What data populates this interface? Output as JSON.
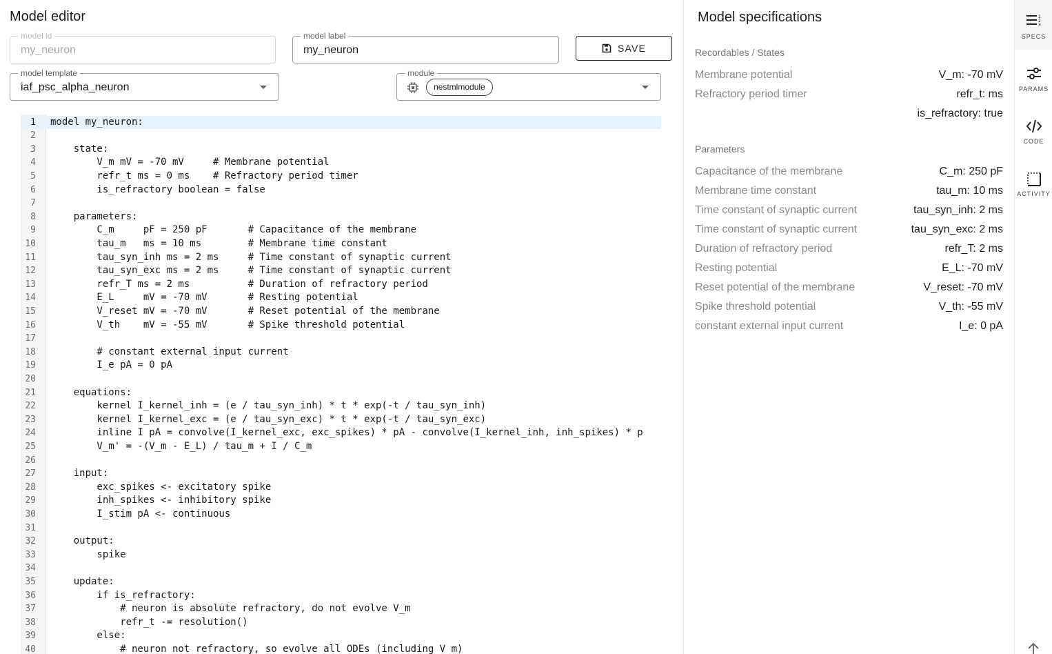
{
  "editor": {
    "title": "Model editor",
    "model_id": {
      "label": "model id",
      "value": "my_neuron",
      "disabled": true
    },
    "model_label": {
      "label": "model label",
      "value": "my_neuron"
    },
    "save_label": "SAVE",
    "model_template": {
      "label": "model template",
      "value": "iaf_psc_alpha_neuron"
    },
    "module": {
      "label": "module",
      "chip": "nestmlmodule"
    },
    "active_line": 1,
    "code": {
      "lines": [
        "model my_neuron:",
        "",
        "    state:",
        "        V_m mV = -70 mV     # Membrane potential",
        "        refr_t ms = 0 ms    # Refractory period timer",
        "        is_refractory boolean = false",
        "",
        "    parameters:",
        "        C_m     pF = 250 pF       # Capacitance of the membrane",
        "        tau_m   ms = 10 ms        # Membrane time constant",
        "        tau_syn_inh ms = 2 ms     # Time constant of synaptic current",
        "        tau_syn_exc ms = 2 ms     # Time constant of synaptic current",
        "        refr_T ms = 2 ms          # Duration of refractory period",
        "        E_L     mV = -70 mV       # Resting potential",
        "        V_reset mV = -70 mV       # Reset potential of the membrane",
        "        V_th    mV = -55 mV       # Spike threshold potential",
        "",
        "        # constant external input current",
        "        I_e pA = 0 pA",
        "",
        "    equations:",
        "        kernel I_kernel_inh = (e / tau_syn_inh) * t * exp(-t / tau_syn_inh)",
        "        kernel I_kernel_exc = (e / tau_syn_exc) * t * exp(-t / tau_syn_exc)",
        "        inline I pA = convolve(I_kernel_exc, exc_spikes) * pA - convolve(I_kernel_inh, inh_spikes) * p",
        "        V_m' = -(V_m - E_L) / tau_m + I / C_m",
        "",
        "    input:",
        "        exc_spikes <- excitatory spike",
        "        inh_spikes <- inhibitory spike",
        "        I_stim pA <- continuous",
        "",
        "    output:",
        "        spike",
        "",
        "    update:",
        "        if is_refractory:",
        "            # neuron is absolute refractory, do not evolve V_m",
        "            refr_t -= resolution()",
        "        else:",
        "            # neuron not refractory, so evolve all ODEs (including V_m)"
      ]
    }
  },
  "specs": {
    "title": "Model specifications",
    "recordables": {
      "title": "Recordables / States",
      "rows": [
        {
          "label": "Membrane potential",
          "value": "V_m: -70 mV"
        },
        {
          "label": "Refractory period timer",
          "value": "refr_t: ms"
        },
        {
          "label": "",
          "value": "is_refractory: true"
        }
      ]
    },
    "parameters": {
      "title": "Parameters",
      "rows": [
        {
          "label": "Capacitance of the membrane",
          "value": "C_m: 250 pF"
        },
        {
          "label": "Membrane time constant",
          "value": "tau_m: 10 ms"
        },
        {
          "label": "Time constant of synaptic current",
          "value": "tau_syn_inh: 2 ms"
        },
        {
          "label": "Time constant of synaptic current",
          "value": "tau_syn_exc: 2 ms"
        },
        {
          "label": "Duration of refractory period",
          "value": "refr_T: 2 ms"
        },
        {
          "label": "Resting potential",
          "value": "E_L: -70 mV"
        },
        {
          "label": "Reset potential of the membrane",
          "value": "V_reset: -70 mV"
        },
        {
          "label": "Spike threshold potential",
          "value": "V_th: -55 mV"
        },
        {
          "label": "constant external input current",
          "value": "I_e: 0 pA"
        }
      ]
    }
  },
  "rail": {
    "active": "specs",
    "items": [
      {
        "id": "specs",
        "label": "SPECS",
        "icon": "specs-list-icon"
      },
      {
        "id": "params",
        "label": "PARAMS",
        "icon": "sliders-icon"
      },
      {
        "id": "code",
        "label": "CODE",
        "icon": "code-icon"
      },
      {
        "id": "activity",
        "label": "ACTIVITY",
        "icon": "activity-icon"
      }
    ],
    "scroll_icon": "arrow-up-icon"
  }
}
